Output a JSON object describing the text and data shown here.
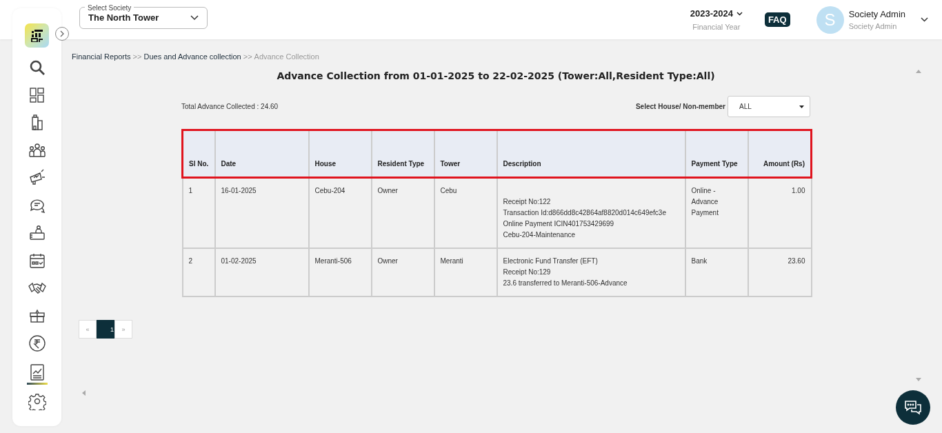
{
  "header": {
    "society_select": {
      "label": "Select Society",
      "value": "The North Tower"
    },
    "financial_year": {
      "value": "2023-2024",
      "caption": "Financial Year"
    },
    "faq": "FAQ",
    "user": {
      "initial": "S",
      "name": "Society Admin",
      "role": "Society Admin"
    }
  },
  "sidebar": {
    "items": [
      {
        "kind": "search",
        "selected": false
      },
      {
        "kind": "dashboard",
        "selected": false
      },
      {
        "kind": "building",
        "selected": false
      },
      {
        "kind": "people",
        "selected": false
      },
      {
        "kind": "megaphone",
        "selected": false
      },
      {
        "kind": "chat",
        "selected": false
      },
      {
        "kind": "desk",
        "selected": false
      },
      {
        "kind": "calendar",
        "selected": false
      },
      {
        "kind": "handshake",
        "selected": false
      },
      {
        "kind": "gift",
        "selected": false
      },
      {
        "kind": "rupee",
        "selected": false
      },
      {
        "kind": "report",
        "selected": true
      },
      {
        "kind": "settings",
        "selected": false
      }
    ]
  },
  "breadcrumb": [
    "Financial Reports",
    ">>",
    "Dues and Advance collection",
    ">>",
    "Advance Collection"
  ],
  "report": {
    "title": "Advance Collection from 01-01-2025 to 22-02-2025 (Tower:All,Resident Type:All)",
    "total": "Total Advance Collected : 24.60",
    "filter": {
      "label": "Select House/ Non-member",
      "value": "ALL"
    }
  },
  "table": {
    "columns": [
      "Sl No.",
      "Date",
      "House",
      "Resident Type",
      "Tower",
      "Description",
      "Payment Type",
      "Amount (Rs)"
    ],
    "rows": [
      {
        "sl": "1",
        "date": "16-01-2025",
        "house": "Cebu-204",
        "resident_type": "Owner",
        "tower": "Cebu",
        "description": [
          "Receipt No:122",
          "Transaction Id:d866dd8c42864af8820d014c649efc3e",
          "Online Payment ICIN401753429699",
          "Cebu-204-Maintenance"
        ],
        "payment_type": "Online - Advance Payment",
        "amount": "1.00"
      },
      {
        "sl": "2",
        "date": "01-02-2025",
        "house": "Meranti-506",
        "resident_type": "Owner",
        "tower": "Meranti",
        "description": [
          "Electronic Fund Transfer (EFT)",
          "Receipt No:129",
          "23.6 transferred to Meranti-506-Advance"
        ],
        "payment_type": "Bank",
        "amount": "23.60"
      }
    ]
  },
  "pagination": {
    "prev": "«",
    "pages": [
      {
        "label": "1",
        "selected": true
      }
    ],
    "next": "»"
  }
}
